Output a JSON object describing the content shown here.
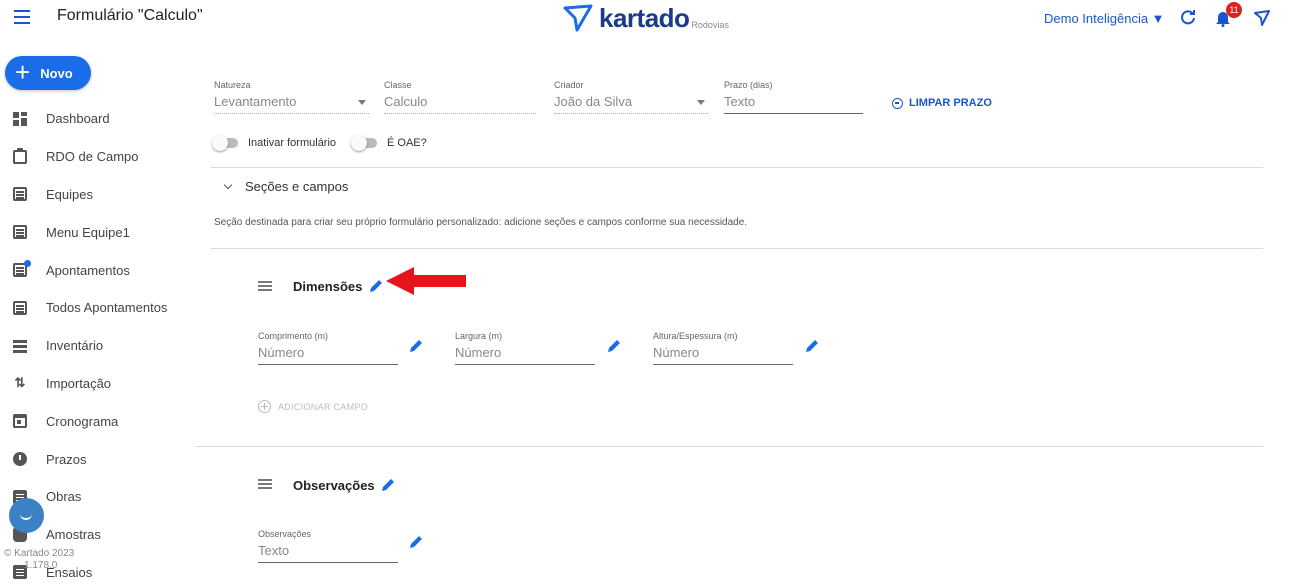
{
  "header": {
    "title": "Formulário \"Calculo\"",
    "logo_text": "kartado",
    "logo_sub": "Rodovias",
    "company": "Demo Inteligência ▼",
    "notifications": "11"
  },
  "sidebar": {
    "new_label": "Novo",
    "items": [
      {
        "label": "Dashboard",
        "icon": "dashboard-icon"
      },
      {
        "label": "RDO de Campo",
        "icon": "clipboard-icon"
      },
      {
        "label": "Equipes",
        "icon": "list-icon"
      },
      {
        "label": "Menu Equipe1",
        "icon": "list-icon"
      },
      {
        "label": "Apontamentos",
        "icon": "list-icon"
      },
      {
        "label": "Todos Apontamentos",
        "icon": "list-icon"
      },
      {
        "label": "Inventário",
        "icon": "inventory-icon"
      },
      {
        "label": "Importação",
        "icon": "import-icon"
      },
      {
        "label": "Cronograma",
        "icon": "calendar-icon"
      },
      {
        "label": "Prazos",
        "icon": "clock-icon"
      },
      {
        "label": "Obras",
        "icon": "clipboard-icon"
      },
      {
        "label": "Amostras",
        "icon": "flask-icon"
      },
      {
        "label": "Ensaios",
        "icon": "test-icon"
      }
    ],
    "copyright": "© Kartado 2023",
    "version": "1.178.0"
  },
  "form": {
    "natureza": {
      "label": "Natureza",
      "value": "Levantamento"
    },
    "classe": {
      "label": "Classe",
      "value": "Calculo"
    },
    "criador": {
      "label": "Criador",
      "value": "João da Silva"
    },
    "prazo": {
      "label": "Prazo (dias)",
      "placeholder": "Texto"
    },
    "clear_label": "LIMPAR PRAZO",
    "toggle_inativar": "Inativar formulário",
    "toggle_oae": "É OAE?"
  },
  "sections_header": {
    "label": "Seções e campos",
    "description": "Seção destinada para criar seu próprio formulário personalizado: adicione seções e campos conforme sua necessidade."
  },
  "sections": [
    {
      "title": "Dimensões",
      "fields": [
        {
          "label": "Comprimento (m)",
          "placeholder": "Número"
        },
        {
          "label": "Largura (m)",
          "placeholder": "Número"
        },
        {
          "label": "Altura/Espessura (m)",
          "placeholder": "Número"
        }
      ],
      "add_field": "ADICIONAR CAMPO"
    },
    {
      "title": "Observações",
      "fields": [
        {
          "label": "Observações",
          "placeholder": "Texto"
        }
      ]
    }
  ],
  "colors": {
    "accent": "#1a56c9",
    "button": "#1a6ce8",
    "annotation_arrow": "#e8141c"
  }
}
